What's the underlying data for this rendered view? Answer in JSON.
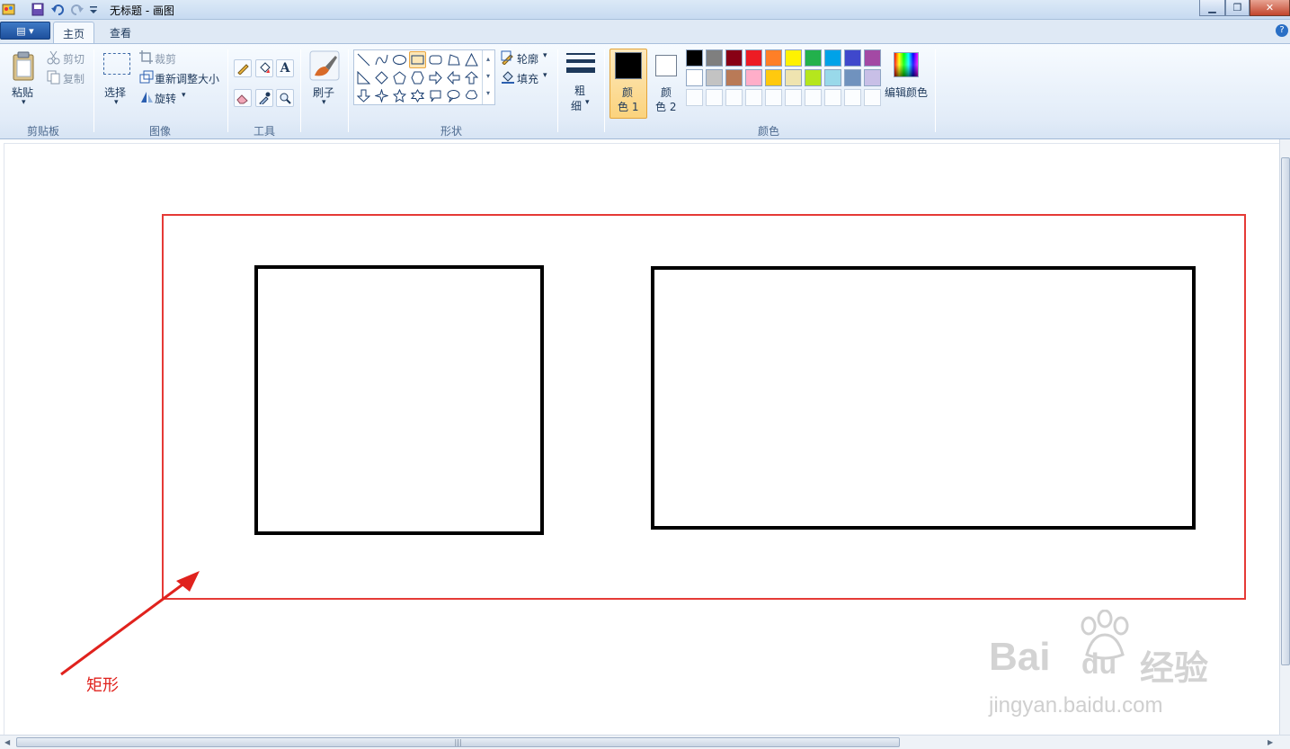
{
  "window": {
    "title": "无标题 - 画图",
    "buttons": {
      "minimize": "▁",
      "maximize": "❐",
      "close": "✕"
    }
  },
  "tabs": {
    "app_menu": "▤ ▾",
    "home": "主页",
    "view": "查看",
    "help": "?"
  },
  "ribbon": {
    "clipboard": {
      "paste": "粘贴",
      "cut": "剪切",
      "copy": "复制",
      "label": "剪贴板"
    },
    "image": {
      "select": "选择",
      "crop": "裁剪",
      "resize": "重新调整大小",
      "rotate": "旋转",
      "label": "图像"
    },
    "tools": {
      "label": "工具",
      "text_tool": "A"
    },
    "brushes": {
      "label": "刷子"
    },
    "shapes": {
      "label": "形状",
      "outline": "轮廓",
      "fill": "填充"
    },
    "size": {
      "line1": "粗",
      "line2": "细"
    },
    "colors": {
      "color1_line1": "颜",
      "color1_line2": "色 1",
      "color2_line1": "颜",
      "color2_line2": "色 2",
      "edit": "编辑颜色",
      "label": "颜色",
      "palette_row1": [
        "#000000",
        "#7f7f7f",
        "#880015",
        "#ed1c24",
        "#ff7f27",
        "#fff200",
        "#22b14c",
        "#00a2e8",
        "#3f48cc",
        "#a349a4"
      ],
      "palette_row2": [
        "#ffffff",
        "#c3c3c3",
        "#b97a57",
        "#ffaec9",
        "#ffc90e",
        "#efe4b0",
        "#b5e61d",
        "#99d9ea",
        "#7092be",
        "#c8bfe7"
      ]
    }
  },
  "annotation": {
    "label": "矩形",
    "color": "#e0221d"
  },
  "watermark": {
    "brand": "Bai",
    "brand2": "du",
    "product": "经验",
    "url": "jingyan.baidu.com"
  }
}
